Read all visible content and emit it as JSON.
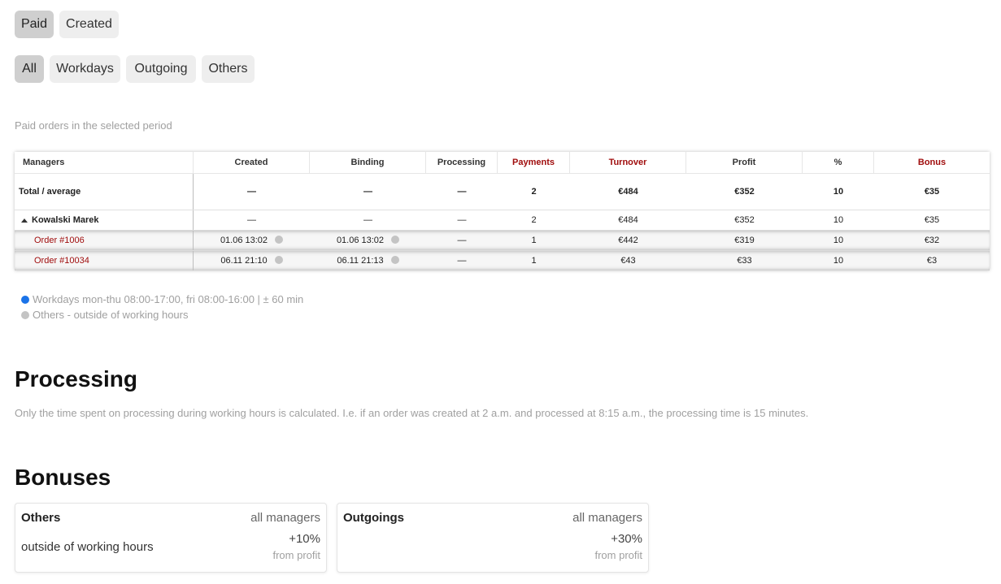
{
  "filters": {
    "period": [
      {
        "label": "Paid",
        "active": true
      },
      {
        "label": "Created",
        "active": false
      }
    ],
    "type": [
      {
        "label": "All",
        "active": true
      },
      {
        "label": "Workdays",
        "active": false
      },
      {
        "label": "Outgoing",
        "active": false
      },
      {
        "label": "Others",
        "active": false
      }
    ]
  },
  "subtitle": "Paid orders in the selected period",
  "table": {
    "headers": [
      "Managers",
      "Created",
      "Binding",
      "Processing",
      "Payments",
      "Turnover",
      "Profit",
      "%",
      "Bonus"
    ],
    "total": [
      "Total / average",
      "—",
      "—",
      "—",
      "2",
      "€484",
      "€352",
      "10",
      "€35"
    ],
    "manager": [
      "Kowalski Marek",
      "—",
      "—",
      "—",
      "2",
      "€484",
      "€352",
      "10",
      "€35"
    ],
    "orders": [
      [
        "Order #1006",
        "01.06 13:02",
        "01.06 13:02",
        "—",
        "1",
        "€442",
        "€319",
        "10",
        "€32"
      ],
      [
        "Order #10034",
        "06.11 21:10",
        "06.11 21:13",
        "—",
        "1",
        "€43",
        "€33",
        "10",
        "€3"
      ]
    ]
  },
  "legend": {
    "workdays": "Workdays mon-thu 08:00-17:00, fri 08:00-16:00 | ± 60 min",
    "others": "Others - outside of working hours"
  },
  "processing": {
    "title": "Processing",
    "text": "Only the time spent on processing during working hours is calculated. I.e. if an order was created at 2 a.m. and processed at 8:15 a.m., the processing time is 15 minutes."
  },
  "bonuses": {
    "title": "Bonuses",
    "cards": [
      {
        "title": "Others",
        "scope": "all managers",
        "desc": "outside of working hours",
        "value": "+10%",
        "sub": "from profit"
      },
      {
        "title": "Outgoings",
        "scope": "all managers",
        "desc": "",
        "value": "+30%",
        "sub": "from profit"
      }
    ]
  },
  "colors": {
    "accent_red": "#a00d0d",
    "profit_green": "#1bb01b",
    "workday_dot": "#1a73e8",
    "other_dot": "#c4c4c4"
  },
  "icons": {
    "expand": "caret-up-icon",
    "time_status": "status-dot-icon"
  }
}
